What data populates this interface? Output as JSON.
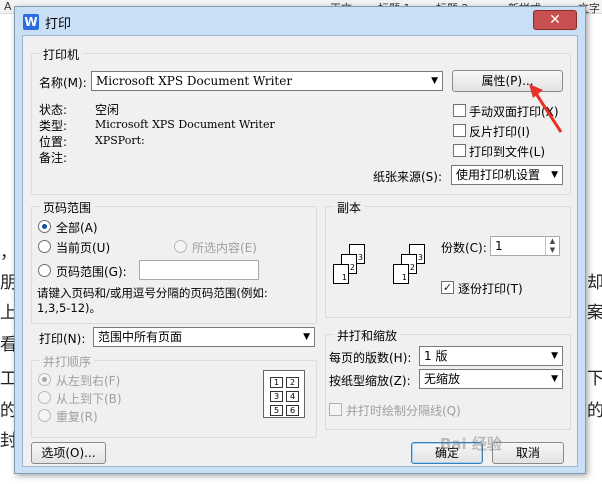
{
  "background": {
    "toolbar_items": [
      "A",
      "正文",
      "标题 1",
      "标题 2",
      "新样式",
      "文字"
    ],
    "side_chars": [
      "，",
      "朋",
      "上",
      "看",
      "工",
      "的",
      "的",
      "封"
    ],
    "right_chars": [
      "却",
      "案",
      "下",
      "的"
    ]
  },
  "dialog": {
    "title": "打印",
    "app_icon": "W",
    "close_symbol": "✕"
  },
  "printer": {
    "group_title": "打印机",
    "name_label": "名称(M):",
    "name_value": "Microsoft XPS Document Writer",
    "properties_button": "属性(P)...",
    "status_label": "状态:",
    "status_value": "空闲",
    "type_label": "类型:",
    "type_value": "Microsoft XPS Document Writer",
    "location_label": "位置:",
    "location_value": "XPSPort:",
    "comment_label": "备注:",
    "comment_value": "",
    "manual_duplex": "手动双面打印(X)",
    "reverse_print": "反片打印(I)",
    "print_to_file": "打印到文件(L)",
    "paper_source_label": "纸张来源(S):",
    "paper_source_value": "使用打印机设置"
  },
  "page_range": {
    "group_title": "页码范围",
    "all": "全部(A)",
    "current_page": "当前页(U)",
    "selection": "所选内容(E)",
    "pages": "页码范围(G):",
    "pages_value": "",
    "hint": "请键入页码和/或用逗号分隔的页码范围(例如:",
    "hint2": "1,3,5-12)。",
    "selected": "all"
  },
  "print_what": {
    "label": "打印(N):",
    "value": "范围中所有页面"
  },
  "collate_order": {
    "group_title": "并打顺序",
    "left_to_right": "从左到右(F)",
    "top_to_bottom": "从上到下(B)",
    "repeat": "重复(R)",
    "cells": [
      "1",
      "2",
      "3",
      "4",
      "5",
      "6"
    ]
  },
  "copies": {
    "group_title": "副本",
    "count_label": "份数(C):",
    "count_value": "1",
    "collate_label": "逐份打印(T)",
    "collate_checked": true,
    "icon_numbers": [
      "1",
      "2",
      "3",
      "1",
      "2",
      "3"
    ]
  },
  "zoom": {
    "group_title": "并打和缩放",
    "pages_per_sheet_label": "每页的版数(H):",
    "pages_per_sheet_value": "1 版",
    "scale_label": "按纸型缩放(Z):",
    "scale_value": "无缩放",
    "draw_borders": "并打时绘制分隔线(Q)"
  },
  "footer": {
    "options_button": "选项(O)...",
    "ok_button": "确定",
    "cancel_button": "取消"
  },
  "watermark": "Bai 经验",
  "colors": {
    "accent_arrow": "#e8302a",
    "dialog_frame": "#c9dff6"
  }
}
